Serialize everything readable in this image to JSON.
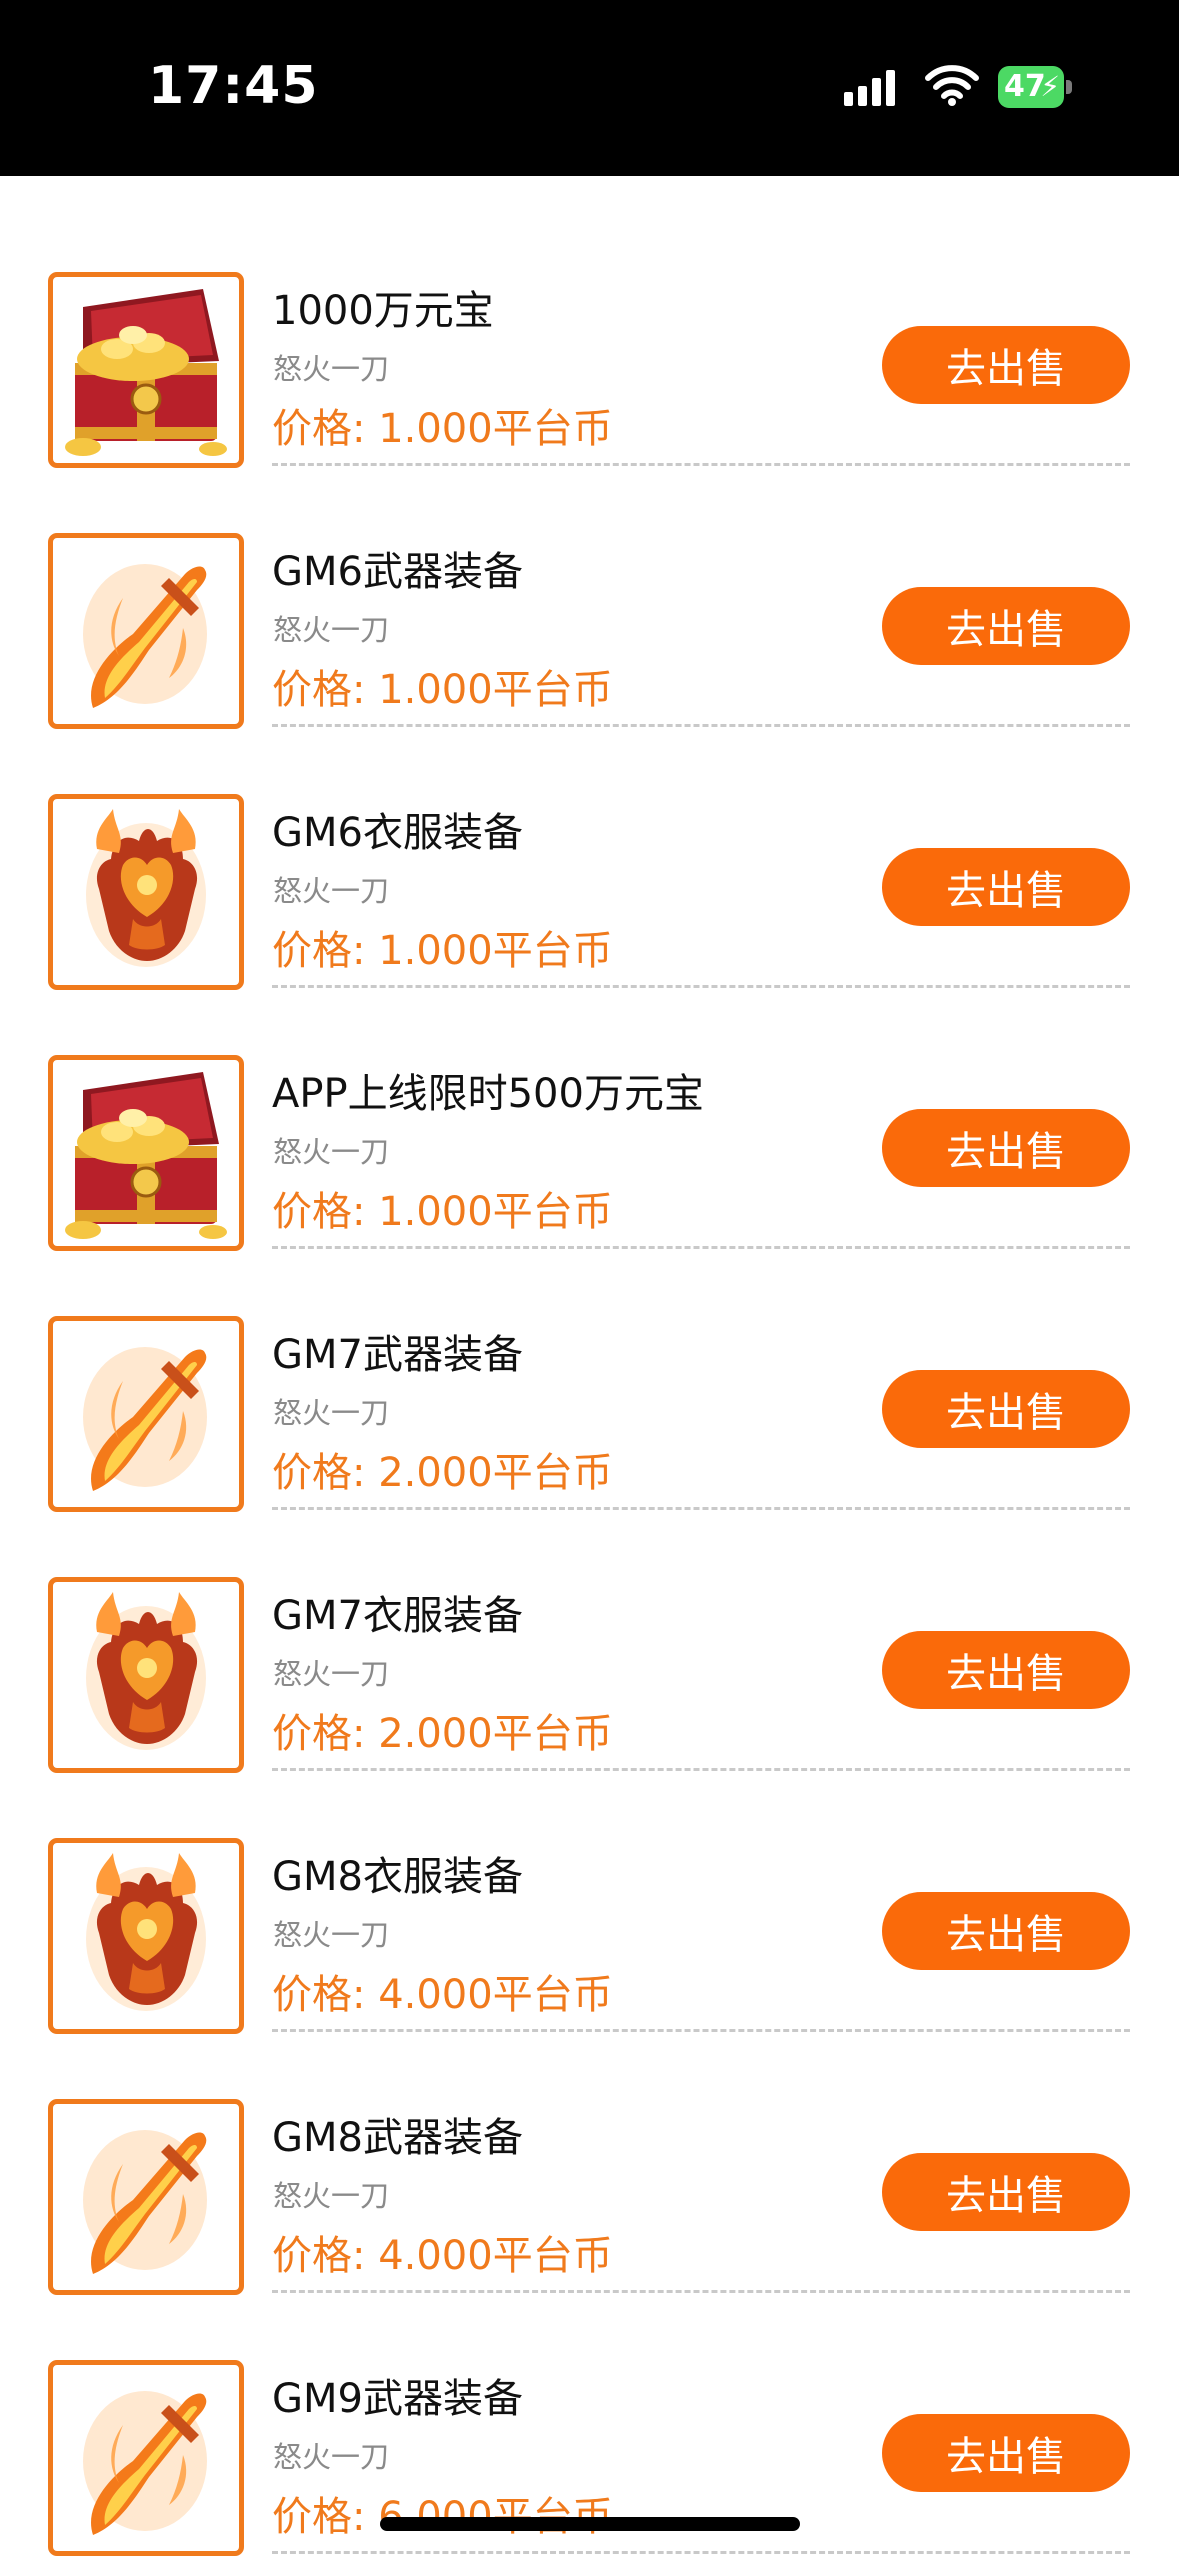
{
  "status_bar": {
    "time": "17:45",
    "battery": "47"
  },
  "items": [
    {
      "title": "1000万元宝",
      "seller": "怒火一刀",
      "price": "价格: 1.000平台币",
      "button": "去出售",
      "icon": "treasure-chest"
    },
    {
      "title": "GM6武器装备",
      "seller": "怒火一刀",
      "price": "价格: 1.000平台币",
      "button": "去出售",
      "icon": "flame-sword"
    },
    {
      "title": "GM6衣服装备",
      "seller": "怒火一刀",
      "price": "价格: 1.000平台币",
      "button": "去出售",
      "icon": "flame-armor"
    },
    {
      "title": "APP上线限时500万元宝",
      "seller": "怒火一刀",
      "price": "价格: 1.000平台币",
      "button": "去出售",
      "icon": "treasure-chest"
    },
    {
      "title": "GM7武器装备",
      "seller": "怒火一刀",
      "price": "价格: 2.000平台币",
      "button": "去出售",
      "icon": "flame-sword"
    },
    {
      "title": "GM7衣服装备",
      "seller": "怒火一刀",
      "price": "价格: 2.000平台币",
      "button": "去出售",
      "icon": "flame-armor"
    },
    {
      "title": "GM8衣服装备",
      "seller": "怒火一刀",
      "price": "价格: 4.000平台币",
      "button": "去出售",
      "icon": "flame-armor"
    },
    {
      "title": "GM8武器装备",
      "seller": "怒火一刀",
      "price": "价格: 4.000平台币",
      "button": "去出售",
      "icon": "flame-sword"
    },
    {
      "title": "GM9武器装备",
      "seller": "怒火一刀",
      "price": "价格: 6.000平台币",
      "button": "去出售",
      "icon": "flame-sword"
    }
  ],
  "colors": {
    "accent": "#fa6a0a",
    "price": "#f07a1c",
    "status_bar": "#000000"
  }
}
